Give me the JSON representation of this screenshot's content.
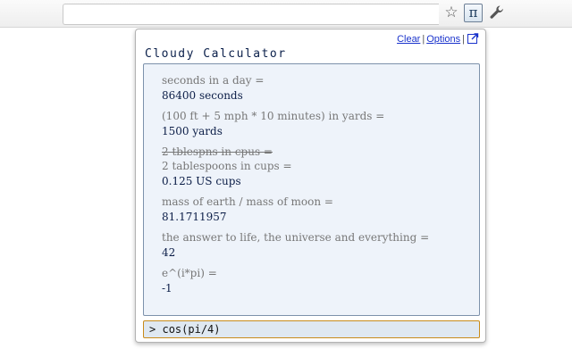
{
  "browser": {
    "star_icon": "star-icon",
    "pi_button_label": "π",
    "wrench_icon": "wrench-icon"
  },
  "popup": {
    "title": "Cloudy Calculator",
    "links": {
      "clear": "Clear",
      "options": "Options",
      "separator": "|",
      "popout_icon": "popout-icon"
    },
    "results": [
      {
        "queries": [
          {
            "text": "seconds in a day =",
            "struck": false
          }
        ],
        "answer": "86400 seconds"
      },
      {
        "queries": [
          {
            "text": "(100 ft + 5 mph * 10 minutes) in yards =",
            "struck": false
          }
        ],
        "answer": "1500 yards"
      },
      {
        "queries": [
          {
            "text": "2 tblespns in cpus =",
            "struck": true
          },
          {
            "text": "2 tablespoons in cups =",
            "struck": false
          }
        ],
        "answer": "0.125 US cups"
      },
      {
        "queries": [
          {
            "text": "mass of earth / mass of moon =",
            "struck": false
          }
        ],
        "answer": "81.1711957"
      },
      {
        "queries": [
          {
            "text": "the answer to life, the universe and everything =",
            "struck": false
          }
        ],
        "answer": "42"
      },
      {
        "queries": [
          {
            "text": "e^(i*pi) =",
            "struck": false
          }
        ],
        "answer": "-1"
      }
    ],
    "input": {
      "prompt": ">",
      "value": "cos(pi/4)"
    }
  },
  "colors": {
    "results_bg": "#eef3fa",
    "answer_text": "#0b1d47",
    "query_text": "#777777",
    "input_border": "#c88b1a",
    "link": "#1a33cc"
  }
}
